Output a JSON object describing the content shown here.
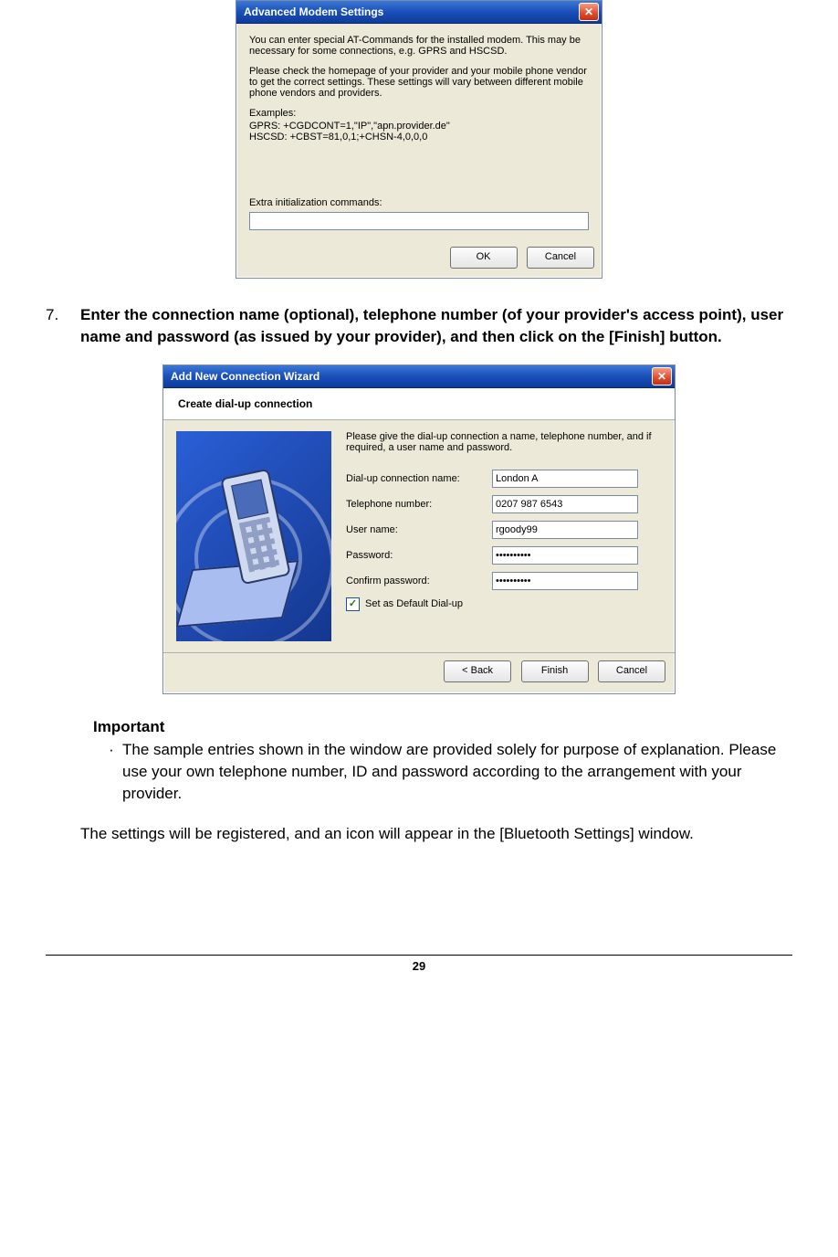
{
  "dialog1": {
    "title": "Advanced Modem Settings",
    "para1": "You can enter special AT-Commands for the installed modem. This may be necessary for some connections, e.g. GPRS and HSCSD.",
    "para2": "Please check the homepage of your provider and your mobile phone vendor to get the correct settings. These settings will vary between different mobile phone vendors and providers.",
    "examples_label": "Examples:",
    "example_gprs": "GPRS: +CGDCONT=1,\"IP\",\"apn.provider.de\"",
    "example_hscsd": "HSCSD: +CBST=81,0,1;+CHSN-4,0,0,0",
    "extra_label": "Extra initialization commands:",
    "ok": "OK",
    "cancel": "Cancel"
  },
  "step7": {
    "num": "7.",
    "text": "Enter the connection name (optional), telephone number (of your provider's access point), user name and password (as issued by your provider), and then click on the [Finish] button."
  },
  "dialog2": {
    "title": "Add New Connection Wizard",
    "subtitle": "Create dial-up connection",
    "instruction": "Please give the dial-up connection a name, telephone number, and if required, a user name and password.",
    "labels": {
      "conn": "Dial-up connection name:",
      "tel": "Telephone number:",
      "user": "User name:",
      "pass": "Password:",
      "confirm": "Confirm password:",
      "default": "Set as Default Dial-up"
    },
    "values": {
      "conn": "London A",
      "tel": "0207 987 6543",
      "user": "rgoody99",
      "pass": "••••••••••",
      "confirm": "••••••••••"
    },
    "back": "< Back",
    "finish": "Finish",
    "cancel": "Cancel"
  },
  "important": {
    "heading": "Important",
    "bullet": "The sample entries shown in the window are provided solely for purpose of explanation. Please use your own telephone number, ID and password according to the arrangement with your provider."
  },
  "result_text": "The settings will be registered, and an icon will appear in the [Bluetooth Settings] window.",
  "page_number": "29"
}
